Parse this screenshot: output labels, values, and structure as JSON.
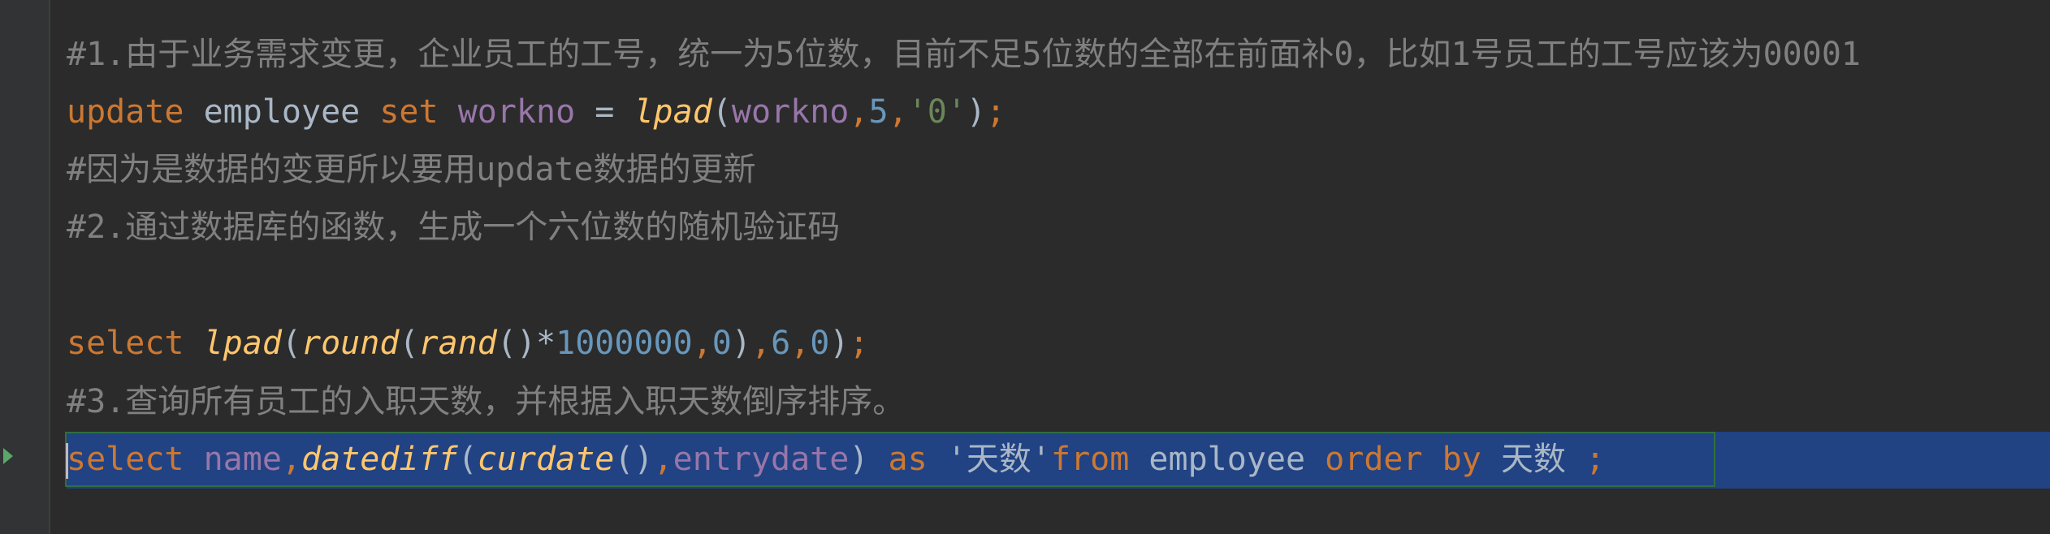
{
  "editor": {
    "lines": {
      "l1": {
        "comment": "#1.由于业务需求变更，企业员工的工号，统一为5位数，目前不足5位数的全部在前面补0，比如1号员工的工号应该为00001"
      },
      "l2": {
        "kw_update": "update",
        "table": "employee",
        "kw_set": "set",
        "col": "workno",
        "eq": "=",
        "fn_lpad": "lpad",
        "paren_open": "(",
        "arg_col": "workno",
        "comma1": ",",
        "num5": "5",
        "comma2": ",",
        "str0": "'0'",
        "paren_close": ")",
        "semi": ";"
      },
      "l3": {
        "comment": "#因为是数据的变更所以要用update数据的更新"
      },
      "l4": {
        "comment": "#2.通过数据库的函数，生成一个六位数的随机验证码"
      },
      "l6": {
        "kw_select": "select",
        "fn_lpad": "lpad",
        "p1": "(",
        "fn_round": "round",
        "p2": "(",
        "fn_rand": "rand",
        "p3": "()",
        "star": "*",
        "num_million": "1000000",
        "c1": ",",
        "num0a": "0",
        "p4": ")",
        "c2": ",",
        "num6": "6",
        "c3": ",",
        "num0b": "0",
        "p5": ")",
        "semi": ";"
      },
      "l7": {
        "comment": "#3.查询所有员工的入职天数，并根据入职天数倒序排序。"
      },
      "l8": {
        "kw_select": "select",
        "col_name": "name",
        "c1": ",",
        "fn_datediff": "datediff",
        "p1": "(",
        "fn_curdate": "curdate",
        "p2": "()",
        "c2": ",",
        "col_entry": "entrydate",
        "p3": ")",
        "kw_as": "as",
        "str_alias": "'天数'",
        "kw_from": "from",
        "table": "employee",
        "kw_order": "order",
        "kw_by": "by",
        "alias": "天数",
        "semi": ";"
      }
    }
  },
  "colors": {
    "background": "#2b2b2b",
    "keyword": "#cc7832",
    "comment": "#808080",
    "function": "#ffc66d",
    "number": "#6897bb",
    "column": "#9876aa",
    "string": "#6a8759",
    "selection": "#214283"
  }
}
